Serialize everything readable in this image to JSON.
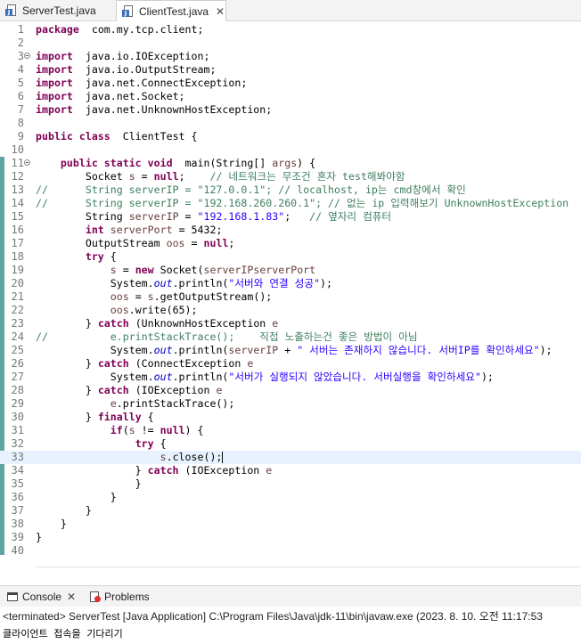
{
  "editor_tabs": [
    {
      "label": "ServerTest.java",
      "active": false
    },
    {
      "label": "ClientTest.java",
      "active": true,
      "close": "✕"
    }
  ],
  "code_lines": [
    {
      "n": "1",
      "c": [
        [
          "kw",
          "package"
        ],
        [
          "",
          "  com.my.tcp.client;"
        ]
      ]
    },
    {
      "n": "2",
      "c": []
    },
    {
      "n": "3",
      "fold": true,
      "c": [
        [
          "kw",
          "import"
        ],
        [
          "",
          "  java.io.IOException;"
        ]
      ]
    },
    {
      "n": "4",
      "c": [
        [
          "kw",
          "import"
        ],
        [
          "",
          "  java.io.OutputStream;"
        ]
      ]
    },
    {
      "n": "5",
      "c": [
        [
          "kw",
          "import"
        ],
        [
          "",
          "  java.net.ConnectException;"
        ]
      ]
    },
    {
      "n": "6",
      "c": [
        [
          "kw",
          "import"
        ],
        [
          "",
          "  java.net.Socket;"
        ]
      ]
    },
    {
      "n": "7",
      "c": [
        [
          "kw",
          "import"
        ],
        [
          "",
          "  java.net.UnknownHostException;"
        ]
      ]
    },
    {
      "n": "8",
      "c": []
    },
    {
      "n": "9",
      "c": [
        [
          "kw",
          "public class"
        ],
        [
          "",
          "  ClientTest {"
        ]
      ]
    },
    {
      "n": "10",
      "c": []
    },
    {
      "n": "11",
      "fold": true,
      "c": [
        [
          "",
          "    "
        ],
        [
          "kw",
          "public static void"
        ],
        [
          "",
          "  main(String[] "
        ],
        [
          "var",
          "args"
        ],
        [
          "",
          ") {"
        ]
      ]
    },
    {
      "n": "12",
      "c": [
        [
          "",
          "        Socket "
        ],
        [
          "var",
          "s"
        ],
        [
          "",
          " = "
        ],
        [
          "kw",
          "null"
        ],
        [
          "",
          ";    "
        ],
        [
          "cmt",
          "// 네트워크는 무조건 혼자 test해봐야함"
        ]
      ]
    },
    {
      "n": "13",
      "c": [
        [
          "cmt",
          "//      String serverIP = \"127.0.0.1\"; // localhost, ip는 cmd창에서 확인"
        ]
      ]
    },
    {
      "n": "14",
      "c": [
        [
          "cmt",
          "//      String serverIP = \"192.168.260.260.1\"; // 없는 ip 입력해보기 UnknownHostException"
        ]
      ]
    },
    {
      "n": "15",
      "c": [
        [
          "",
          "        String "
        ],
        [
          "var",
          "serverIP"
        ],
        [
          "",
          " = "
        ],
        [
          "str",
          "\"192.168.1.83\""
        ],
        [
          "",
          ";   "
        ],
        [
          "cmt",
          "// 옆자리 컴퓨터"
        ]
      ]
    },
    {
      "n": "16",
      "c": [
        [
          "",
          "        "
        ],
        [
          "kw",
          "int"
        ],
        [
          "",
          "",
          " "
        ],
        [
          "var",
          "serverPort"
        ],
        [
          "",
          " = 5432;"
        ]
      ]
    },
    {
      "n": "17",
      "c": [
        [
          "",
          "        OutputStream "
        ],
        [
          "var",
          "oos"
        ],
        [
          "",
          " = "
        ],
        [
          "kw",
          "null"
        ],
        [
          "",
          ";"
        ]
      ]
    },
    {
      "n": "18",
      "c": [
        [
          "",
          "        "
        ],
        [
          "kw",
          "try"
        ],
        [
          "",
          " {"
        ]
      ]
    },
    {
      "n": "19",
      "c": [
        [
          "",
          "            "
        ],
        [
          "var",
          "s"
        ],
        [
          "",
          " = "
        ],
        [
          "kw",
          "new"
        ],
        [
          "",
          " Socket("
        ],
        [
          "var",
          "serverIP"
        ],
        [
          ", "
        ],
        [
          "var",
          "serverPort"
        ],
        [
          ");"
        ]
      ]
    },
    {
      "n": "20",
      "c": [
        [
          "",
          "            System."
        ],
        [
          "fld",
          "out"
        ],
        [
          "",
          ".println("
        ],
        [
          "str",
          "\"서버와 연결 성공\""
        ],
        [
          "",
          ");"
        ]
      ]
    },
    {
      "n": "21",
      "c": [
        [
          "",
          "            "
        ],
        [
          "var",
          "oos"
        ],
        [
          "",
          " = "
        ],
        [
          "var",
          "s"
        ],
        [
          "",
          ".getOutputStream();"
        ]
      ]
    },
    {
      "n": "22",
      "c": [
        [
          "",
          "            "
        ],
        [
          "var",
          "oos"
        ],
        [
          "",
          ".write(65);"
        ]
      ]
    },
    {
      "n": "23",
      "c": [
        [
          "",
          "        } "
        ],
        [
          "kw",
          "catch"
        ],
        [
          "",
          " (UnknownHostException "
        ],
        [
          "var",
          "e"
        ],
        [
          ") {"
        ]
      ]
    },
    {
      "n": "24",
      "c": [
        [
          "cmt",
          "//          e.printStackTrace();    직접 노출하는건 좋은 방법이 아님"
        ]
      ]
    },
    {
      "n": "25",
      "c": [
        [
          "",
          "            System."
        ],
        [
          "fld",
          "out"
        ],
        [
          "",
          ".println("
        ],
        [
          "var",
          "serverIP"
        ],
        [
          "",
          " + "
        ],
        [
          "str",
          "\" 서버는 존재하지 않습니다. 서버IP를 확인하세요\""
        ],
        [
          "",
          ");"
        ]
      ]
    },
    {
      "n": "26",
      "c": [
        [
          "",
          "        } "
        ],
        [
          "kw",
          "catch"
        ],
        [
          "",
          " (ConnectException "
        ],
        [
          "var",
          "e"
        ],
        [
          ") {"
        ]
      ]
    },
    {
      "n": "27",
      "c": [
        [
          "",
          "            System."
        ],
        [
          "fld",
          "out"
        ],
        [
          "",
          ".println("
        ],
        [
          "str",
          "\"서버가 실행되지 않았습니다. 서버실행을 확인하세요\""
        ],
        [
          "",
          ");"
        ]
      ]
    },
    {
      "n": "28",
      "c": [
        [
          "",
          "        } "
        ],
        [
          "kw",
          "catch"
        ],
        [
          "",
          " (IOException "
        ],
        [
          "var",
          "e"
        ],
        [
          ") {"
        ]
      ]
    },
    {
      "n": "29",
      "c": [
        [
          "",
          "            "
        ],
        [
          "var",
          "e"
        ],
        [
          "",
          ".printStackTrace();"
        ]
      ]
    },
    {
      "n": "30",
      "c": [
        [
          "",
          "        } "
        ],
        [
          "kw",
          "finally"
        ],
        [
          "",
          " {"
        ]
      ]
    },
    {
      "n": "31",
      "c": [
        [
          "",
          "            "
        ],
        [
          "kw",
          "if"
        ],
        [
          "",
          "("
        ],
        [
          "var",
          "s"
        ],
        [
          "",
          " != "
        ],
        [
          "kw",
          "null"
        ],
        [
          "",
          ") {"
        ]
      ]
    },
    {
      "n": "32",
      "c": [
        [
          "",
          "                "
        ],
        [
          "kw",
          "try"
        ],
        [
          "",
          " {"
        ]
      ]
    },
    {
      "n": "33",
      "current": true,
      "caret": true,
      "c": [
        [
          "",
          "                    "
        ],
        [
          "var",
          "s"
        ],
        [
          "",
          ".close();"
        ]
      ]
    },
    {
      "n": "34",
      "c": [
        [
          "",
          "                } "
        ],
        [
          "kw",
          "catch"
        ],
        [
          "",
          " (IOException "
        ],
        [
          "var",
          "e"
        ],
        [
          ") {"
        ]
      ]
    },
    {
      "n": "35",
      "c": [
        [
          "",
          "                }"
        ]
      ]
    },
    {
      "n": "36",
      "c": [
        [
          "",
          "            }"
        ]
      ]
    },
    {
      "n": "37",
      "c": [
        [
          "",
          "        }"
        ]
      ]
    },
    {
      "n": "38",
      "c": [
        [
          "",
          "    }"
        ]
      ]
    },
    {
      "n": "39",
      "c": [
        [
          "",
          "}"
        ]
      ]
    },
    {
      "n": "40",
      "c": []
    }
  ],
  "scroll_left_arrow": "<",
  "view_tabs": [
    {
      "label": "Console",
      "close": "✕"
    },
    {
      "label": "Problems"
    }
  ],
  "console": {
    "terminated": "<terminated> ServerTest [Java Application] C:\\Program Files\\Java\\jdk-11\\bin\\javaw.exe  (2023. 8. 10. 오전 11:17:53",
    "output": "클라이언트 접속을 기다리기"
  }
}
